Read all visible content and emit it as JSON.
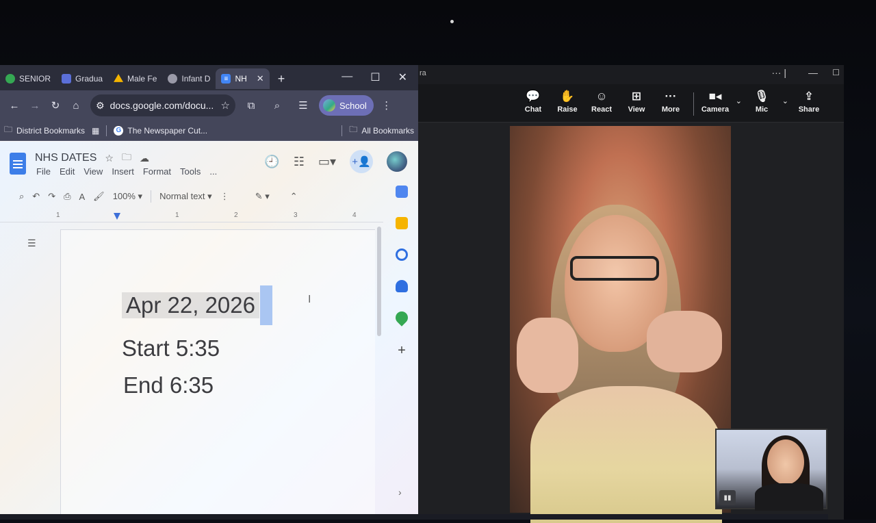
{
  "chrome": {
    "tabs": [
      {
        "label": "SENIOR",
        "fav_color": "#35a853",
        "active": false
      },
      {
        "label": "Gradua",
        "fav_color": "#5b6fd8",
        "active": false
      },
      {
        "label": "Male Fe",
        "fav_color": "#f4b400",
        "active": false
      },
      {
        "label": "Infant D",
        "fav_color": "#9a9aa8",
        "active": false
      },
      {
        "label": "NH",
        "fav_color": "#4285f4",
        "active": true
      }
    ],
    "new_tab": "+",
    "url": "docs.google.com/docu...",
    "profile_label": "School",
    "bookmarks": {
      "district": "District Bookmarks",
      "newspaper": "The Newspaper Cut...",
      "all": "All Bookmarks"
    }
  },
  "docs": {
    "title": "NHS DATES",
    "menu": [
      "File",
      "Edit",
      "View",
      "Insert",
      "Format",
      "Tools",
      "..."
    ],
    "zoom": "100%",
    "style": "Normal text",
    "ruler": [
      "1",
      "1",
      "2",
      "3",
      "4"
    ],
    "content": {
      "line1": "Apr 22, 2026",
      "line2": "Start 5:35",
      "line3": "End 6:35"
    }
  },
  "meeting": {
    "title_fragment": "ra",
    "buttons": {
      "chat": "Chat",
      "raise": "Raise",
      "react": "React",
      "view": "View",
      "more": "More",
      "camera": "Camera",
      "mic": "Mic",
      "share": "Share"
    }
  }
}
